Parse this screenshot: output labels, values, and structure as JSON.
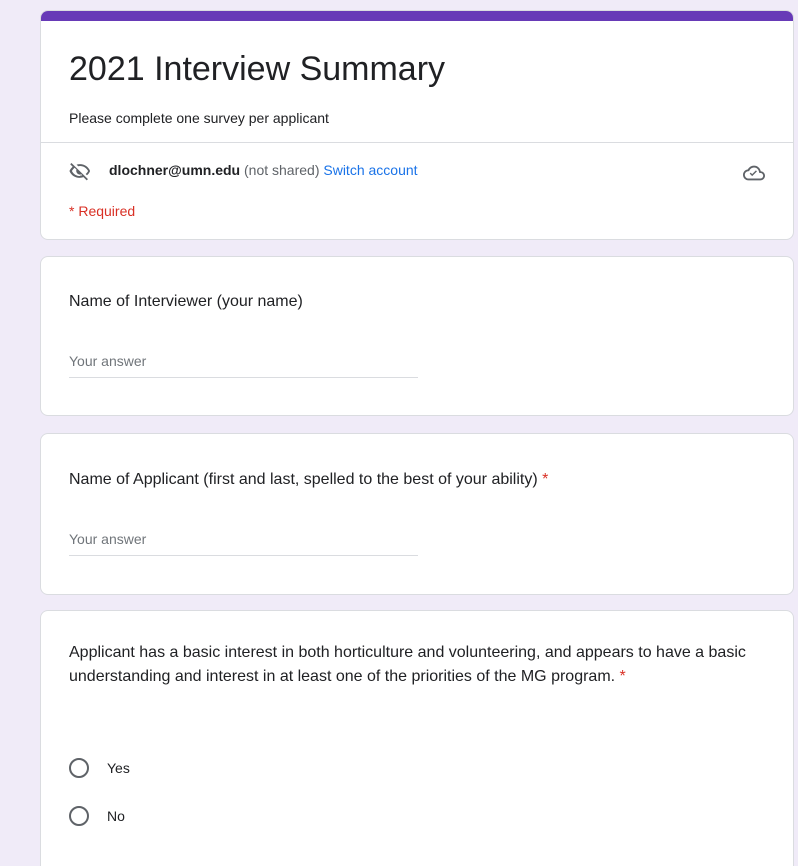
{
  "header": {
    "title": "2021 Interview Summary",
    "description": "Please complete one survey per applicant",
    "account_email": "dlochner@umn.edu",
    "account_note": "(not shared)",
    "switch_account_label": "Switch account",
    "required_note": "* Required",
    "accent_color": "#673ab7"
  },
  "questions": [
    {
      "title": "Name of Interviewer (your name)",
      "placeholder": "Your answer",
      "required": false
    },
    {
      "title": "Name of Applicant (first and last, spelled to the best of your ability)",
      "required_mark": "*",
      "placeholder": "Your answer",
      "required": true
    },
    {
      "title": "Applicant has a basic interest in both horticulture and volunteering, and appears to have a basic understanding and interest in at least one of the priorities of the MG program.",
      "required_mark": "*",
      "required": true,
      "options": [
        "Yes",
        "No"
      ]
    }
  ],
  "icons": {
    "visibility": "eye-off-icon",
    "cloud": "cloud-saved-icon"
  }
}
